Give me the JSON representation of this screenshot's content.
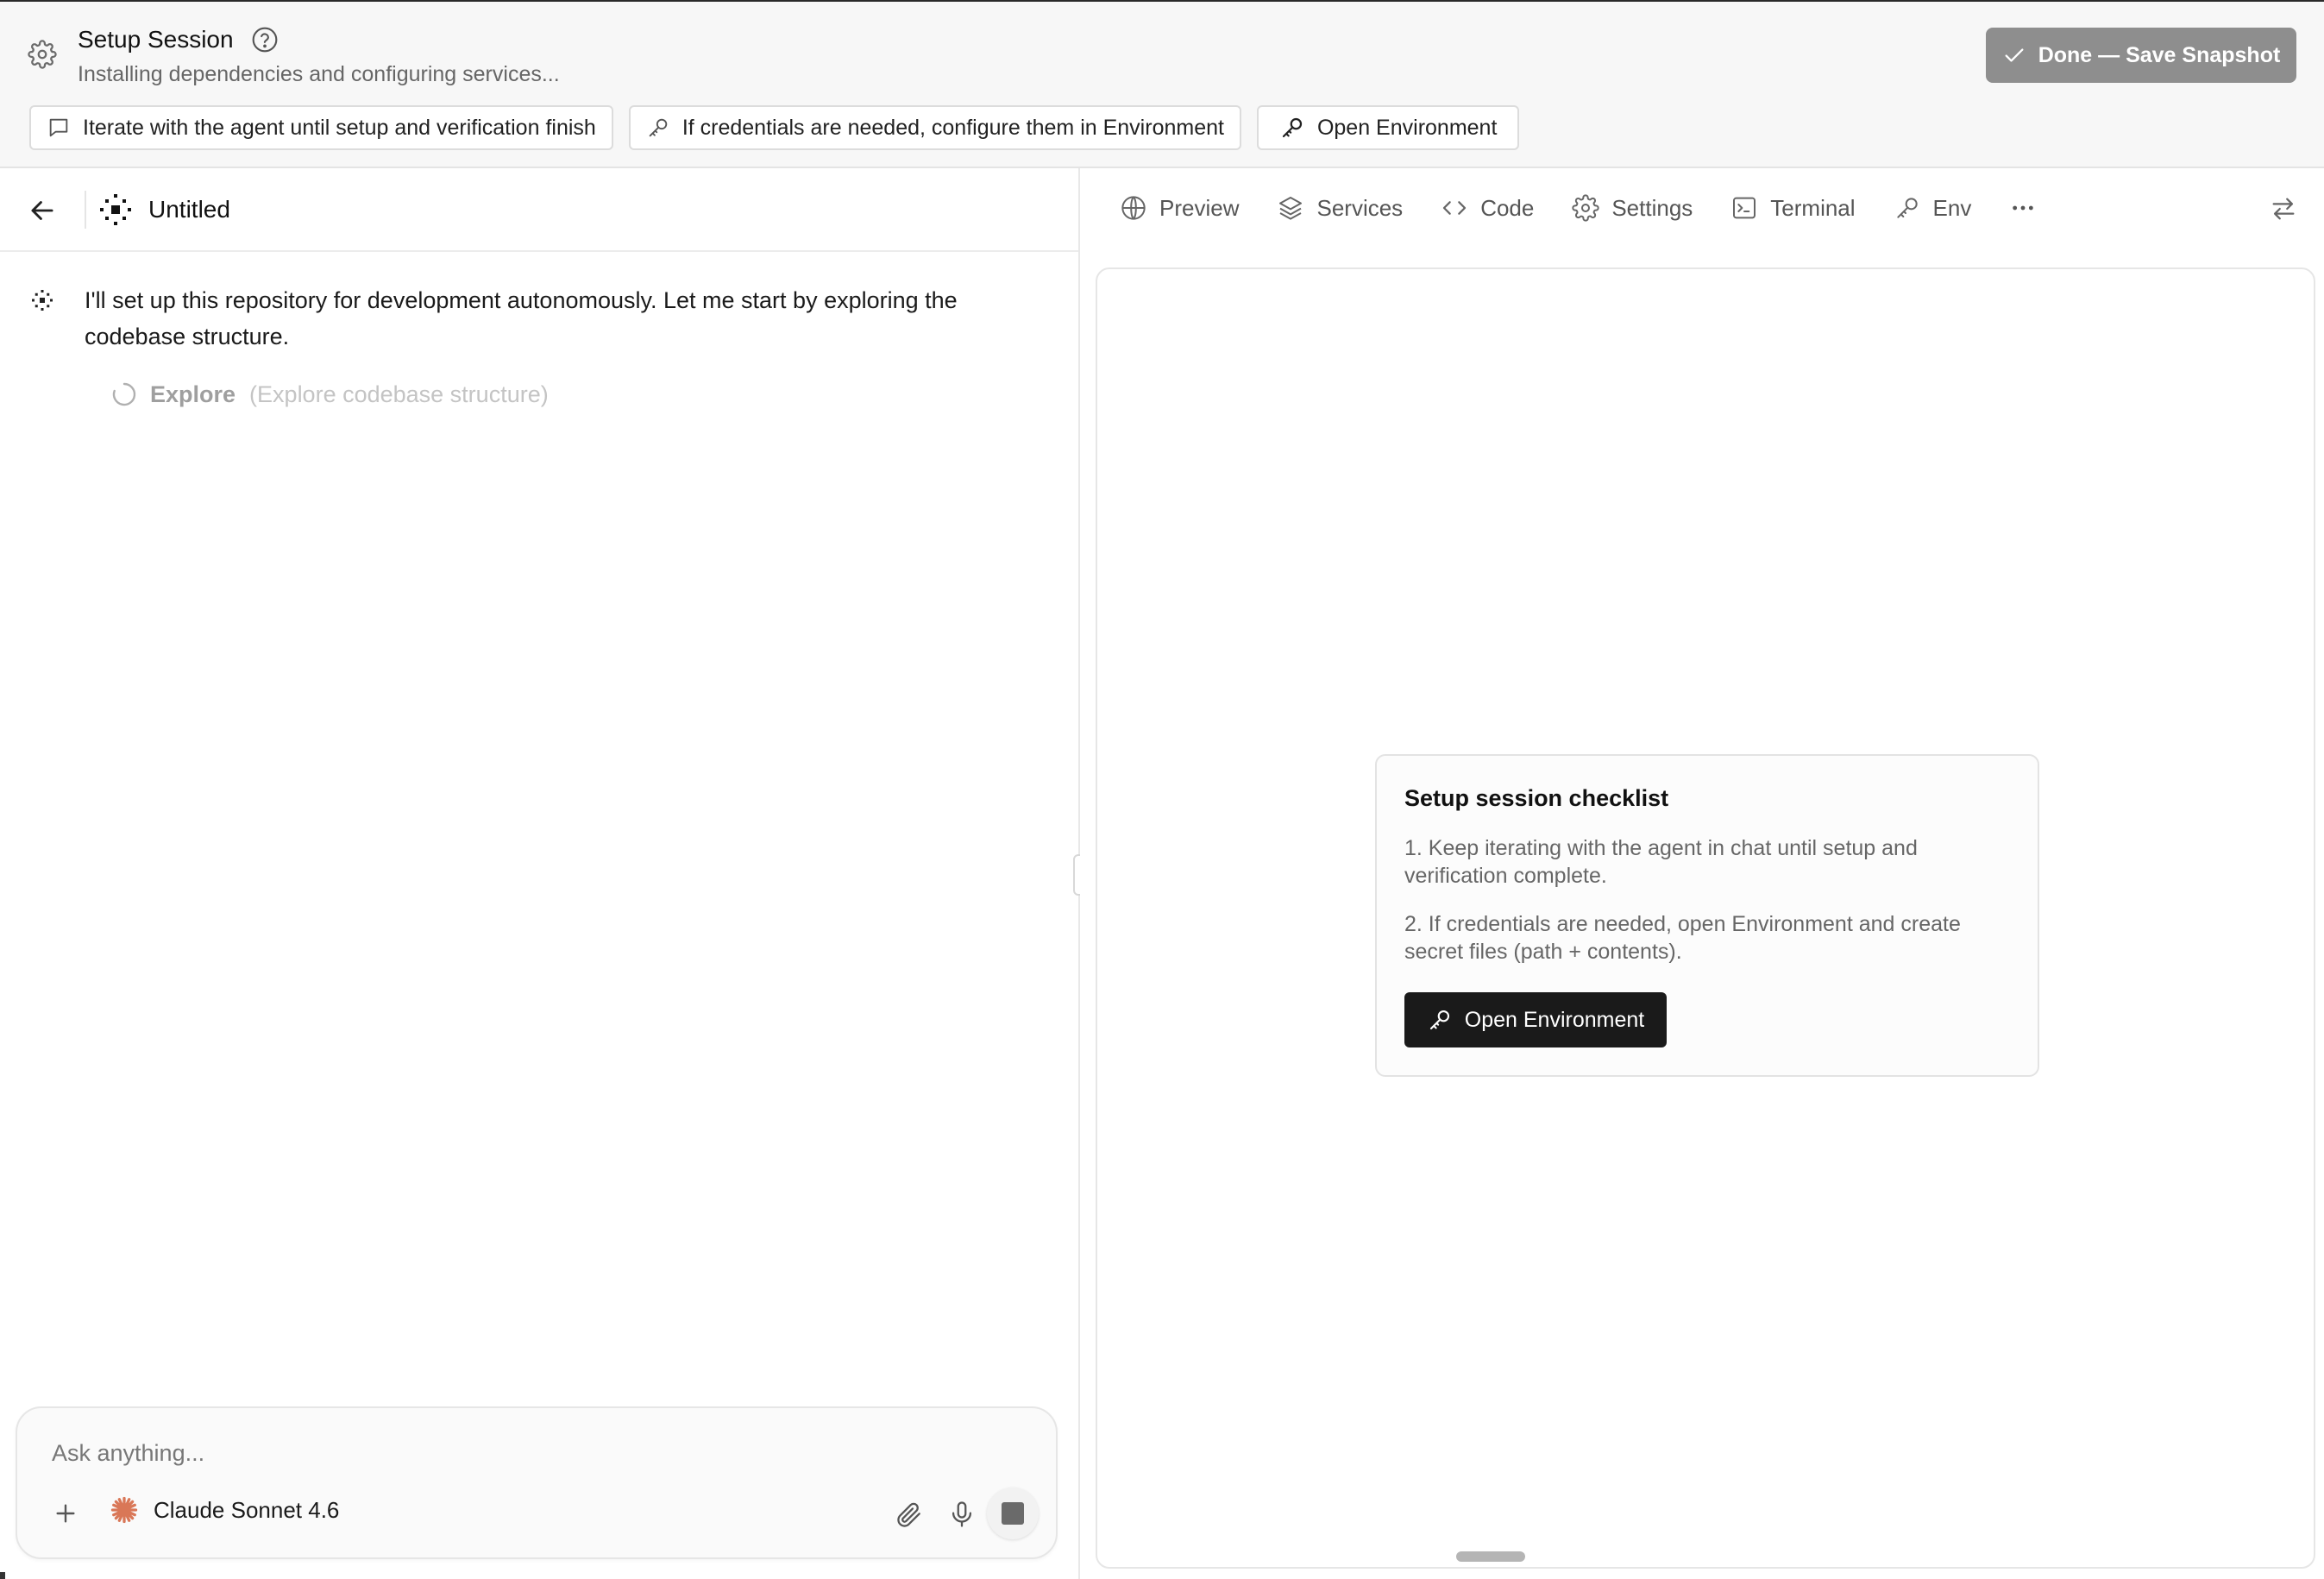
{
  "banner": {
    "title": "Setup Session",
    "subtitle": "Installing dependencies and configuring services...",
    "save_button": "Done — Save Snapshot",
    "chips": [
      {
        "icon": "chat-bubble-icon",
        "label": "Iterate with the agent until setup and verification finish"
      },
      {
        "icon": "key-icon",
        "label": "If credentials are needed, configure them in Environment"
      },
      {
        "icon": "key-icon",
        "label": "Open Environment"
      }
    ]
  },
  "chat": {
    "title": "Untitled",
    "message": "I'll set up this repository for development autonomously. Let me start by exploring the codebase structure.",
    "tool": {
      "name": "Explore",
      "description": "(Explore codebase structure)"
    }
  },
  "composer": {
    "placeholder": "Ask anything...",
    "model": "Claude Sonnet 4.6"
  },
  "tabs": [
    {
      "icon": "globe-icon",
      "label": "Preview"
    },
    {
      "icon": "layers-icon",
      "label": "Services"
    },
    {
      "icon": "code-icon",
      "label": "Code"
    },
    {
      "icon": "gear-icon",
      "label": "Settings"
    },
    {
      "icon": "terminal-icon",
      "label": "Terminal"
    },
    {
      "icon": "key-icon",
      "label": "Env"
    }
  ],
  "checklist": {
    "title": "Setup session checklist",
    "items": [
      "1. Keep iterating with the agent in chat until setup and verification complete.",
      "2. If credentials are needed, open Environment and create secret files (path + contents)."
    ],
    "button": "Open Environment"
  },
  "colors": {
    "save_button_bg": "#8e8e8e",
    "primary_button_bg": "#1a1a1a",
    "claude_accent": "#d97757"
  }
}
